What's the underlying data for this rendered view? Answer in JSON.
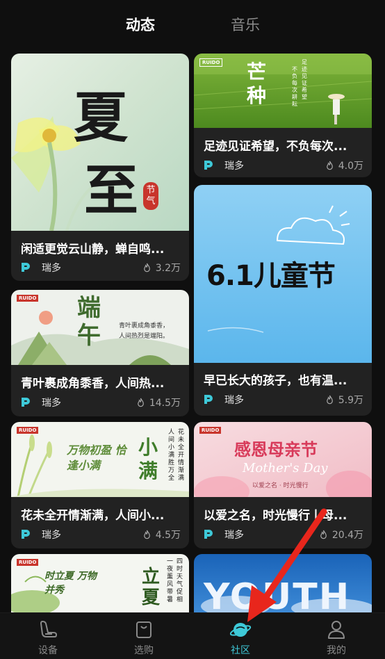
{
  "top_tabs": [
    {
      "label": "动态",
      "active": true
    },
    {
      "label": "音乐",
      "active": false
    }
  ],
  "cards": [
    {
      "id": "summer-solstice",
      "title": "闲适更觉云山静，蝉自鸣...",
      "author": "瑞多",
      "likes": "3.2万",
      "image_text": [
        "夏",
        "至"
      ],
      "image_badge": "节气"
    },
    {
      "id": "grain-in-ear",
      "title": "足迹见证希望，不负每次...",
      "author": "瑞多",
      "likes": "4.0万",
      "image_text": "芒种",
      "image_logo": "RUIDO",
      "image_poem": [
        "足迹见证希望",
        "不负每次耕耘"
      ]
    },
    {
      "id": "dragon-boat",
      "title": "青叶裹成角黍香，人间热...",
      "author": "瑞多",
      "likes": "14.5万",
      "image_text": "端午",
      "image_logo": "RUIDO",
      "image_poem": [
        "青叶裹成角黍香，",
        "人间热烈是端阳。"
      ]
    },
    {
      "id": "childrens-day",
      "title": "早已长大的孩子，也有温...",
      "author": "瑞多",
      "likes": "5.9万",
      "image_text": "6.1儿童节"
    },
    {
      "id": "grain-buds",
      "title": "花未全开情渐满，人间小...",
      "author": "瑞多",
      "likes": "4.5万",
      "image_text": "小满",
      "image_subtext": "万物初盈 恰逢小满",
      "image_logo": "RUIDO",
      "image_poem": [
        "花未全开情渐满",
        "人间小满胜万全"
      ]
    },
    {
      "id": "mothers-day",
      "title": "以爱之名，时光慢行丨母...",
      "author": "瑞多",
      "likes": "20.4万",
      "image_text": "感恩母亲节",
      "image_english": "Mother's Day",
      "image_sub": "以爱之名 · 时光慢行",
      "image_logo": "RUIDO"
    },
    {
      "id": "start-of-summer",
      "title": "",
      "author": "",
      "likes": "",
      "image_text": "立夏",
      "image_subtext": "时立夏 万物并秀",
      "image_logo": "RUIDO",
      "image_poem": [
        "四时天气促相",
        "一夜薰风带暑"
      ]
    },
    {
      "id": "youth-day",
      "title": "",
      "author": "",
      "likes": "",
      "image_text": "YOUTH"
    }
  ],
  "bottom_nav": [
    {
      "label": "设备",
      "icon": "car-seat-icon",
      "active": false
    },
    {
      "label": "选购",
      "icon": "shopping-bag-icon",
      "active": false
    },
    {
      "label": "社区",
      "icon": "planet-icon",
      "active": true
    },
    {
      "label": "我的",
      "icon": "person-icon",
      "active": false
    }
  ],
  "colors": {
    "background": "#0f0f0f",
    "card": "#222222",
    "accent": "#3ec9d8",
    "inactive": "#8a8a8a",
    "annotation_arrow": "#e8261c"
  }
}
